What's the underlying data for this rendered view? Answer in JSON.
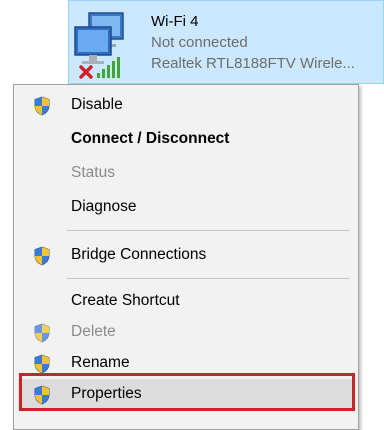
{
  "adapter": {
    "name": "Wi-Fi 4",
    "status": "Not connected",
    "device": "Realtek RTL8188FTV Wirele..."
  },
  "menu": {
    "items": [
      {
        "label": "Disable",
        "icon": "uac-shield-icon",
        "bold": false,
        "disabled": false
      },
      {
        "label": "Connect / Disconnect",
        "icon": "",
        "bold": true,
        "disabled": false
      },
      {
        "label": "Status",
        "icon": "",
        "bold": false,
        "disabled": true
      },
      {
        "label": "Diagnose",
        "icon": "",
        "bold": false,
        "disabled": false
      },
      {
        "label": "Bridge Connections",
        "icon": "uac-shield-icon",
        "bold": false,
        "disabled": false
      },
      {
        "label": "Create Shortcut",
        "icon": "",
        "bold": false,
        "disabled": false
      },
      {
        "label": "Delete",
        "icon": "uac-shield-icon",
        "bold": false,
        "disabled": true
      },
      {
        "label": "Rename",
        "icon": "uac-shield-icon",
        "bold": false,
        "disabled": false
      },
      {
        "label": "Properties",
        "icon": "uac-shield-icon",
        "bold": false,
        "disabled": false,
        "highlighted": true
      }
    ]
  },
  "colors": {
    "selection_bg": "#cce8ff",
    "menu_bg": "#f2f2f2",
    "highlight_border": "#c8242c",
    "disabled_text": "#8a8a8a"
  }
}
